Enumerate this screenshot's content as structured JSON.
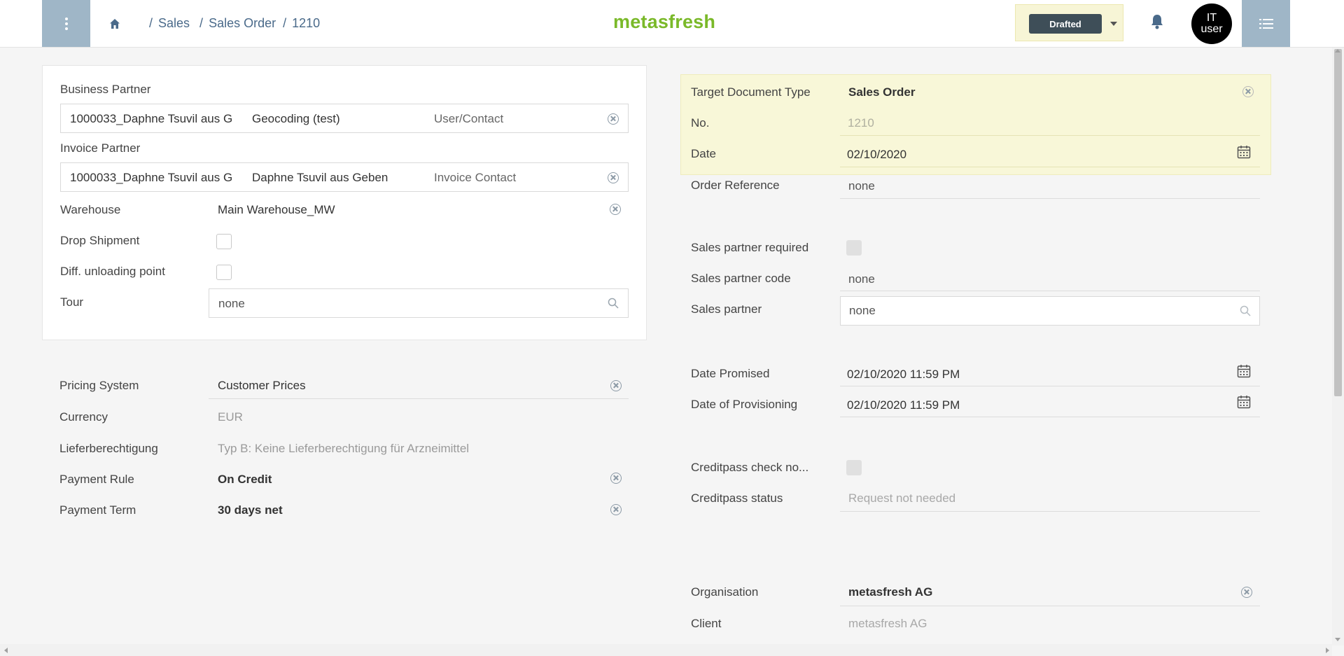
{
  "header": {
    "breadcrumb": [
      "Sales",
      "Sales Order",
      "1210"
    ],
    "logo": "metasfresh",
    "status": "Drafted",
    "avatar_line1": "IT",
    "avatar_line2": "user"
  },
  "left": {
    "business_partner": {
      "label": "Business Partner",
      "partner": "1000033_Daphne Tsuvil aus G",
      "location": "Geocoding (test)",
      "contact": "User/Contact"
    },
    "invoice_partner": {
      "label": "Invoice Partner",
      "partner": "1000033_Daphne Tsuvil aus G",
      "location": "Daphne Tsuvil aus Geben",
      "contact": "Invoice Contact"
    },
    "warehouse": {
      "label": "Warehouse",
      "value": "Main Warehouse_MW"
    },
    "drop_shipment": {
      "label": "Drop Shipment"
    },
    "diff_unloading": {
      "label": "Diff. unloading point"
    },
    "tour": {
      "label": "Tour",
      "value": "none"
    },
    "pricing_system": {
      "label": "Pricing System",
      "value": "Customer Prices"
    },
    "currency": {
      "label": "Currency",
      "value": "EUR"
    },
    "lieferberechtigung": {
      "label": "Lieferberechtigung",
      "value": "Typ B: Keine Lieferberechtigung für Arzneimittel"
    },
    "payment_rule": {
      "label": "Payment Rule",
      "value": "On Credit"
    },
    "payment_term": {
      "label": "Payment Term",
      "value": "30 days net"
    }
  },
  "right": {
    "target_doc_type": {
      "label": "Target Document Type",
      "value": "Sales Order"
    },
    "doc_no": {
      "label": "No.",
      "value": "1210"
    },
    "date": {
      "label": "Date",
      "value": "02/10/2020"
    },
    "order_reference": {
      "label": "Order Reference",
      "value": "none"
    },
    "sales_partner_required": {
      "label": "Sales partner required"
    },
    "sales_partner_code": {
      "label": "Sales partner code",
      "value": "none"
    },
    "sales_partner": {
      "label": "Sales partner",
      "value": "none"
    },
    "date_promised": {
      "label": "Date Promised",
      "value": "02/10/2020 11:59 PM"
    },
    "date_provisioning": {
      "label": "Date of Provisioning",
      "value": "02/10/2020 11:59 PM"
    },
    "creditpass_check": {
      "label": "Creditpass check no..."
    },
    "creditpass_status": {
      "label": "Creditpass status",
      "value": "Request not needed"
    },
    "organisation": {
      "label": "Organisation",
      "value": "metasfresh AG"
    },
    "client": {
      "label": "Client",
      "value": "metasfresh AG"
    }
  },
  "colors": {
    "accent": "#9fb6c7",
    "logo": "#7ab929",
    "status_pill": "#3e4e58",
    "highlight": "#f8f7d8"
  }
}
